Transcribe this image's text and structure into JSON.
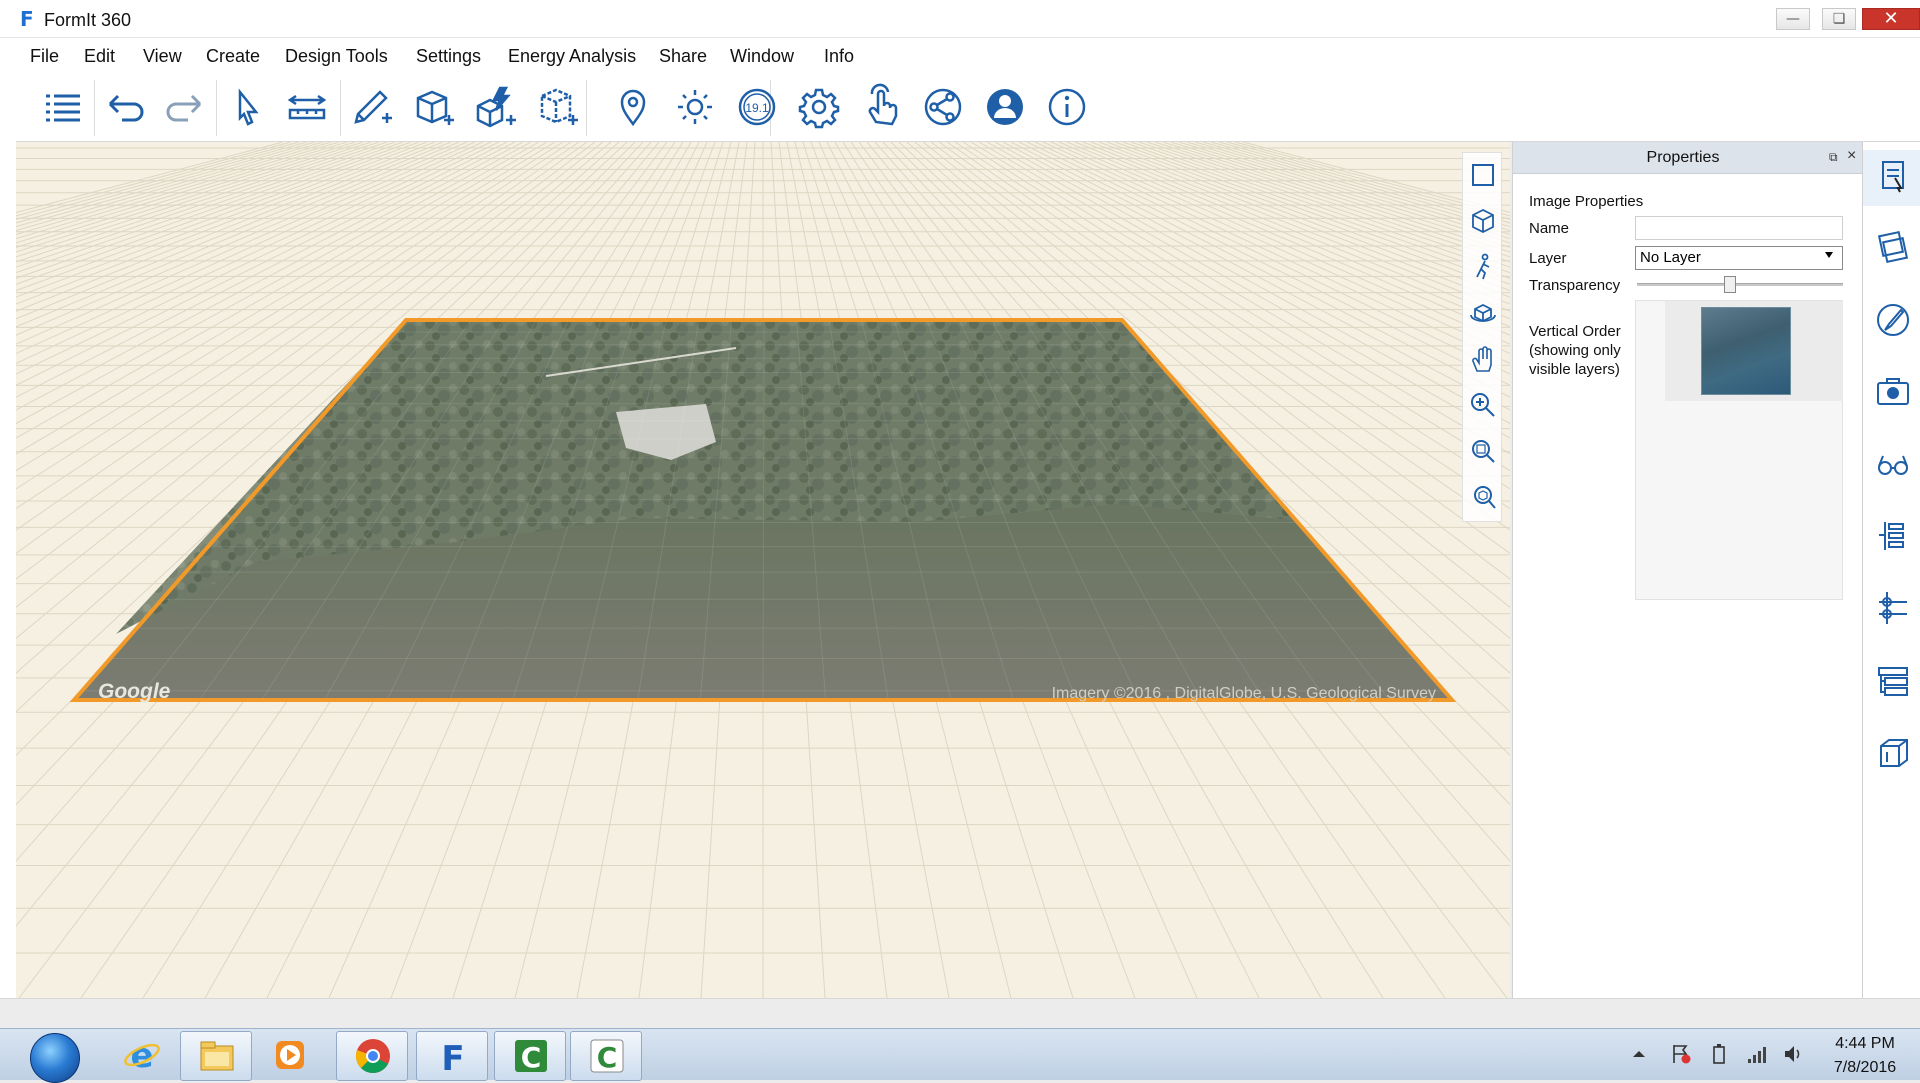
{
  "window": {
    "title": "FormIt 360",
    "logo_letter": "F"
  },
  "menu": [
    "File",
    "Edit",
    "View",
    "Create",
    "Design Tools",
    "Settings",
    "Energy Analysis",
    "Share",
    "Window",
    "Info"
  ],
  "toolbar": {
    "icons": [
      "layers-list-icon",
      "undo-icon",
      "redo-icon",
      "select-arrow-icon",
      "measure-tape-icon",
      "pencil-draw-icon",
      "cube-add-icon",
      "quick-shape-icon",
      "group-add-icon",
      "location-pin-icon",
      "sun-icon",
      "version-badge-icon",
      "settings-gear-icon",
      "touch-gesture-icon",
      "share-icon",
      "account-icon",
      "info-icon"
    ],
    "version_badge": "19.1"
  },
  "viewport": {
    "map_watermark": "Google",
    "map_credit": "Imagery ©2016 , DigitalGlobe, U.S. Geological Survey",
    "nav_icons": [
      "zoom-extents-icon",
      "perspective-cube-icon",
      "walk-icon",
      "orbit-icon",
      "pan-hand-icon",
      "zoom-icon",
      "zoom-window-icon",
      "zoom-selected-icon"
    ]
  },
  "properties": {
    "title": "Properties",
    "section": "Image Properties",
    "name_label": "Name",
    "name_value": "",
    "layer_label": "Layer",
    "layer_value": "No Layer",
    "transparency_label": "Transparency",
    "transparency_value": 0.45,
    "vertical_order_label": "Vertical Order (showing only visible layers)"
  },
  "rail": [
    "properties-panel-icon",
    "materials-icon",
    "paint-brush-icon",
    "scenes-camera-icon",
    "visibility-glasses-icon",
    "layers-tree-icon",
    "levels-icon",
    "groups-icon",
    "content-library-icon"
  ],
  "taskbar": {
    "apps": [
      "internet-explorer-icon",
      "file-explorer-icon",
      "media-player-icon",
      "chrome-icon",
      "formit-icon",
      "camtasia-icon",
      "camtasia-recorder-icon"
    ],
    "time": "4:44 PM",
    "date": "7/8/2016"
  },
  "colors": {
    "accent": "#1f6fd1",
    "selection_outline": "#f19a2a",
    "viewport_bg": "#f5f0e1",
    "grid": "#ddd6c4"
  }
}
